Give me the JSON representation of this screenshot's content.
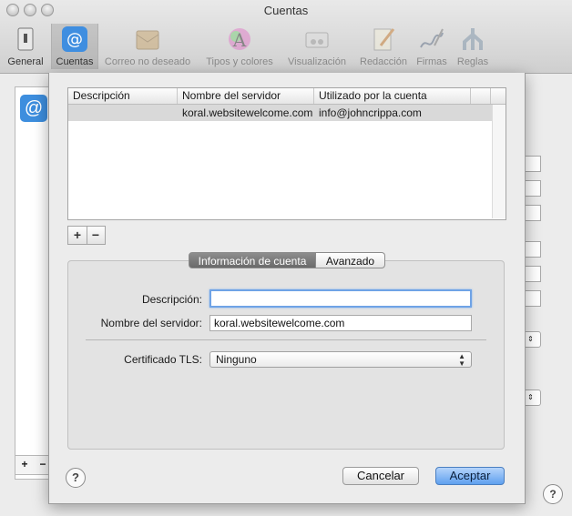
{
  "window": {
    "title": "Cuentas"
  },
  "toolbar": {
    "items": [
      {
        "label": "General",
        "icon": "switch-icon"
      },
      {
        "label": "Cuentas",
        "icon": "at-sign-icon"
      },
      {
        "label": "Correo no deseado",
        "icon": "junk-mail-icon"
      },
      {
        "label": "Tipos y colores",
        "icon": "fonts-colors-icon"
      },
      {
        "label": "Visualización",
        "icon": "viewing-icon"
      },
      {
        "label": "Redacción",
        "icon": "composing-icon"
      },
      {
        "label": "Firmas",
        "icon": "signature-icon"
      },
      {
        "label": "Reglas",
        "icon": "rules-icon"
      }
    ]
  },
  "background": {
    "account_icon": "@",
    "add": "+",
    "remove": "−",
    "help": "?"
  },
  "servers_table": {
    "columns": [
      "Descripción",
      "Nombre del servidor",
      "Utilizado por la cuenta"
    ],
    "rows": [
      {
        "description": "",
        "server": "koral.websitewelcome.com",
        "account": "info@johncrippa.com"
      }
    ],
    "add_label": "+",
    "remove_label": "−"
  },
  "tabs": {
    "active": "Información de cuenta",
    "inactive": "Avanzado"
  },
  "form": {
    "description_label": "Descripción:",
    "description_value": "",
    "server_label": "Nombre del servidor:",
    "server_value": "koral.websitewelcome.com",
    "tls_label": "Certificado TLS:",
    "tls_value": "Ninguno"
  },
  "buttons": {
    "help": "?",
    "cancel": "Cancelar",
    "ok": "Aceptar"
  }
}
